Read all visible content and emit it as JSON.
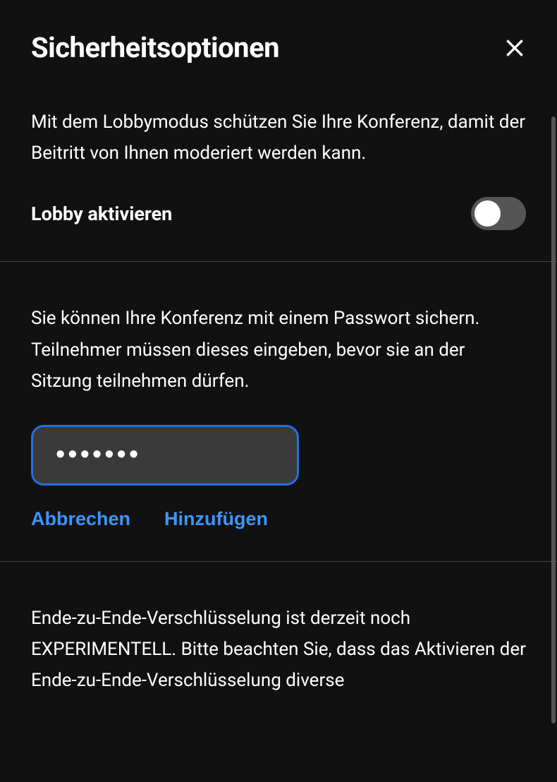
{
  "header": {
    "title": "Sicherheitsoptionen"
  },
  "lobby": {
    "description": "Mit dem Lobbymodus schützen Sie Ihre Konferenz, damit der Beitritt von Ihnen moderiert werden kann.",
    "toggleLabel": "Lobby aktivieren"
  },
  "password": {
    "description": "Sie können Ihre Konferenz mit einem Passwort sichern. Teilnehmer müssen dieses eingeben, bevor sie an der Sitzung teilnehmen dürfen.",
    "value": "•••••••",
    "cancelLabel": "Abbrechen",
    "addLabel": "Hinzufügen"
  },
  "e2e": {
    "description": "Ende-zu-Ende-Verschlüsselung ist derzeit noch EXPERIMENTELL. Bitte beachten Sie, dass das Aktivieren der Ende-zu-Ende-Verschlüsselung diverse"
  }
}
